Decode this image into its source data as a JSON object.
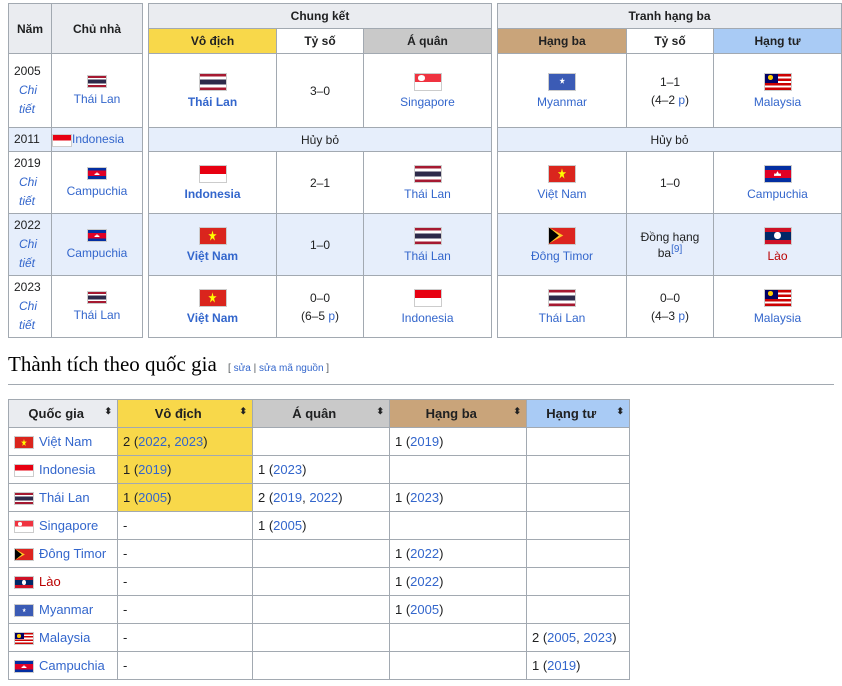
{
  "results": {
    "h_year": "Năm",
    "h_host": "Chủ nhà",
    "h_final": "Chung kết",
    "h_third_place": "Tranh hạng ba",
    "h_champion": "Vô địch",
    "h_score": "Tỷ số",
    "h_runner_up": "Á quân",
    "h_third": "Hạng ba",
    "h_score2": "Tỷ số",
    "h_fourth": "Hạng tư",
    "detail_label": "Chi tiết",
    "cancelled": "Hủy bỏ",
    "p_label": "p",
    "rows": [
      {
        "year": "2005",
        "host": "Thái Lan",
        "host_flag": "thailand-flag-icon",
        "champion": "Thái Lan",
        "champion_flag": "thailand-flag-icon",
        "score": "3–0",
        "runner_up": "Singapore",
        "runner_up_flag": "singapore-flag-icon",
        "third": "Myanmar",
        "third_flag": "myanmar-flag-icon",
        "score2": "1–1",
        "score2_pen_open": "(4–2 ",
        "score2_pen_close": ")",
        "fourth": "Malaysia",
        "fourth_flag": "malaysia-flag-icon"
      },
      {
        "year": "2011",
        "host": "Indonesia",
        "host_flag": "indonesia-flag-icon"
      },
      {
        "year": "2019",
        "host": "Campuchia",
        "host_flag": "cambodia-flag-icon",
        "champion": "Indonesia",
        "champion_flag": "indonesia-flag-icon",
        "score": "2–1",
        "runner_up": "Thái Lan",
        "runner_up_flag": "thailand-flag-icon",
        "third": "Việt Nam",
        "third_flag": "vietnam-flag-icon",
        "score2": "1–0",
        "fourth": "Campuchia",
        "fourth_flag": "cambodia-flag-icon"
      },
      {
        "year": "2022",
        "host": "Campuchia",
        "host_flag": "cambodia-flag-icon",
        "champion": "Việt Nam",
        "champion_flag": "vietnam-flag-icon",
        "score": "1–0",
        "runner_up": "Thái Lan",
        "runner_up_flag": "thailand-flag-icon",
        "third": "Đông Timor",
        "third_flag": "east-timor-flag-icon",
        "score2_line1": "Đồng hạng",
        "score2_line2": "ba",
        "score2_ref": "[9]",
        "fourth": "Lào",
        "fourth_flag": "laos-flag-icon"
      },
      {
        "year": "2023",
        "host": "Thái Lan",
        "host_flag": "thailand-flag-icon",
        "champion": "Việt Nam",
        "champion_flag": "vietnam-flag-icon",
        "score": "0–0",
        "score_pen_open": "(6–5 ",
        "score_pen_close": ")",
        "runner_up": "Indonesia",
        "runner_up_flag": "indonesia-flag-icon",
        "third": "Thái Lan",
        "third_flag": "thailand-flag-icon",
        "score2": "0–0",
        "score2_pen_open": "(4–3 ",
        "score2_pen_close": ")",
        "fourth": "Malaysia",
        "fourth_flag": "malaysia-flag-icon"
      }
    ]
  },
  "section": {
    "title": "Thành tích theo quốc gia",
    "edit_open": "[ ",
    "edit_link": "sửa",
    "edit_sep": " | ",
    "edit_source": "sửa mã nguồn",
    "edit_close": " ]"
  },
  "medals": {
    "h_country": "Quốc gia",
    "h_champion": "Vô địch",
    "h_runner_up": "Á quân",
    "h_third": "Hạng ba",
    "h_fourth": "Hạng tư",
    "sort_glyph": "⬍",
    "dash": "-",
    "rows": [
      {
        "country": "Việt Nam",
        "flag": "vietnam-flag-icon",
        "champion": "2 (",
        "champion_years": [
          "2022",
          "2023"
        ],
        "runner_up": "",
        "third": "1 (",
        "third_years": [
          "2019"
        ],
        "fourth": ""
      },
      {
        "country": "Indonesia",
        "flag": "indonesia-flag-icon",
        "champion": "1 (",
        "champion_years": [
          "2019"
        ],
        "runner_up": "1 (",
        "runner_up_years": [
          "2023"
        ],
        "third": "",
        "fourth": ""
      },
      {
        "country": "Thái Lan",
        "flag": "thailand-flag-icon",
        "champion": "1 (",
        "champion_years": [
          "2005"
        ],
        "runner_up": "2 (",
        "runner_up_years": [
          "2019",
          "2022"
        ],
        "third": "1 (",
        "third_years": [
          "2023"
        ],
        "fourth": ""
      },
      {
        "country": "Singapore",
        "flag": "singapore-flag-icon",
        "champion": "-",
        "runner_up": "1 (",
        "runner_up_years": [
          "2005"
        ],
        "third": "",
        "fourth": ""
      },
      {
        "country": "Đông Timor",
        "flag": "east-timor-flag-icon",
        "champion": "-",
        "runner_up": "",
        "third": "1 (",
        "third_years": [
          "2022"
        ],
        "fourth": ""
      },
      {
        "country": "Lào",
        "flag": "laos-flag-icon",
        "champion": "-",
        "runner_up": "",
        "third": "1 (",
        "third_years": [
          "2022"
        ],
        "fourth": ""
      },
      {
        "country": "Myanmar",
        "flag": "myanmar-flag-icon",
        "champion": "-",
        "runner_up": "",
        "third": "1 (",
        "third_years": [
          "2005"
        ],
        "fourth": ""
      },
      {
        "country": "Malaysia",
        "flag": "malaysia-flag-icon",
        "champion": "-",
        "runner_up": "",
        "third": "",
        "fourth": "2 (",
        "fourth_years": [
          "2005",
          "2023"
        ]
      },
      {
        "country": "Campuchia",
        "flag": "cambodia-flag-icon",
        "champion": "-",
        "runner_up": "",
        "third": "",
        "fourth": "1 (",
        "fourth_years": [
          "2019"
        ]
      }
    ],
    "close_paren": ")",
    "year_sep": ", "
  },
  "colors": {
    "gold": "#f8d84a",
    "silver": "#c9c9c9",
    "bronze": "#c9a47a",
    "fourth": "#a9cbf5",
    "link": "#3366cc",
    "redlink": "#ba0000"
  }
}
